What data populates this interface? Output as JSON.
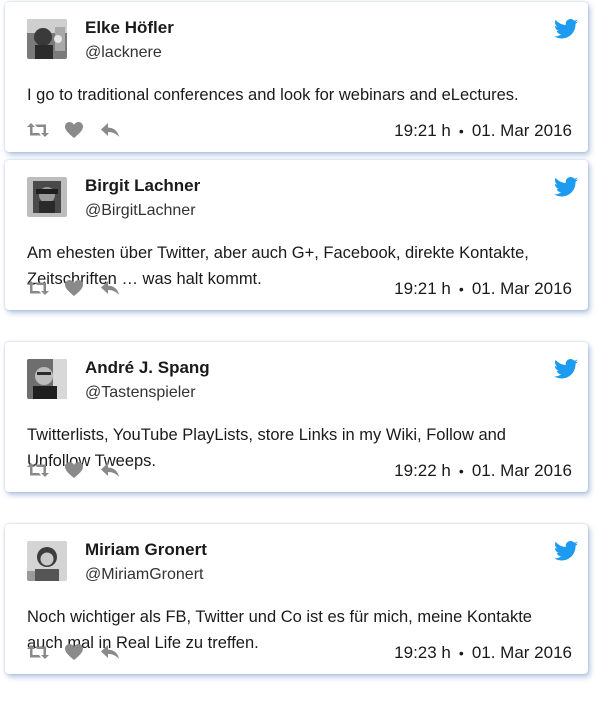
{
  "colors": {
    "twitter_blue": "#1d9bf0",
    "action_gray": "#8a8a8a",
    "card_shadow": "#9bb3d8"
  },
  "icons": {
    "retweet": "retweet-icon",
    "like": "heart-icon",
    "reply": "reply-icon",
    "brand": "twitter-bird-icon"
  },
  "tweets": [
    {
      "name": "Elke Höfler",
      "handle": "@lacknere",
      "text": "I go to traditional conferences and look for webinars and eLectures.",
      "time": "19:21 h",
      "separator": "•",
      "date": "01. Mar 2016"
    },
    {
      "name": "Birgit Lachner",
      "handle": "@BirgitLachner",
      "text": "Am ehesten über Twitter, aber auch G+, Facebook, direkte Kontakte, Zeitschriften … was halt kommt.",
      "time": "19:21 h",
      "separator": "•",
      "date": "01. Mar 2016"
    },
    {
      "name": "André J. Spang",
      "handle": "@Tastenspieler",
      "text": "Twitterlists, YouTube PlayLists, store Links in my Wiki, Follow and Unfollow Tweeps.",
      "time": "19:22 h",
      "separator": "•",
      "date": "01. Mar 2016"
    },
    {
      "name": "Miriam Gronert",
      "handle": "@MiriamGronert",
      "text": "Noch wichtiger als FB, Twitter und Co ist es für mich, meine Kontakte auch mal in Real Life zu treffen.",
      "time": "19:23 h",
      "separator": "•",
      "date": "01. Mar 2016"
    }
  ]
}
